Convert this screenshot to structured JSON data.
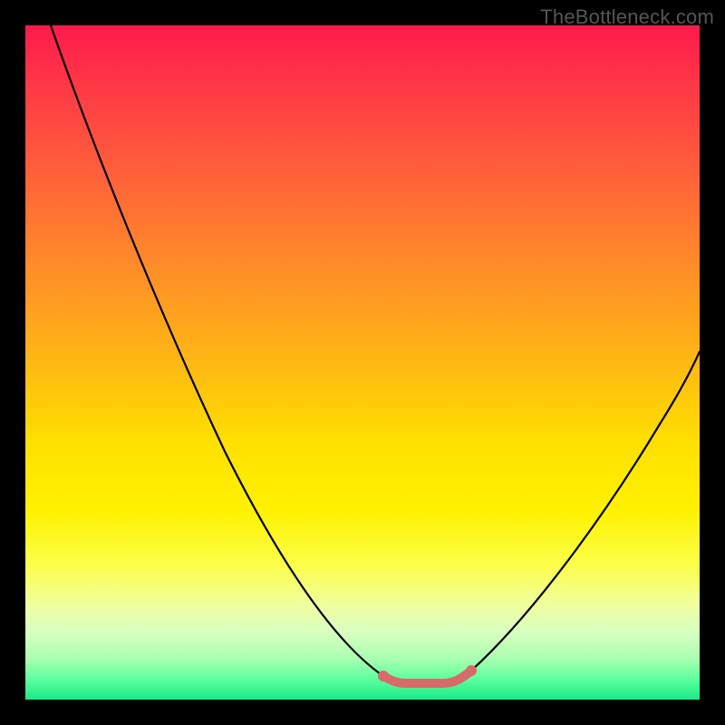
{
  "watermark": "TheBottleneck.com",
  "chart_data": {
    "type": "line",
    "title": "",
    "xlabel": "",
    "ylabel": "",
    "xlim": [
      0,
      100
    ],
    "ylim": [
      0,
      100
    ],
    "series": [
      {
        "name": "curve",
        "x": [
          0,
          5,
          10,
          15,
          20,
          25,
          30,
          35,
          40,
          45,
          50,
          52,
          55,
          58,
          60,
          62,
          65,
          70,
          75,
          80,
          85,
          90,
          95,
          100
        ],
        "y": [
          100,
          91,
          82,
          73,
          64,
          55,
          46,
          37,
          28,
          19,
          10,
          6,
          3,
          2,
          2,
          3,
          6,
          12,
          20,
          28,
          36,
          44,
          52,
          60
        ]
      },
      {
        "name": "flat-marker",
        "x": [
          52,
          54,
          56,
          58,
          60,
          62
        ],
        "y": [
          2,
          2,
          2,
          2,
          2,
          2
        ]
      }
    ],
    "background_gradient": {
      "direction": "vertical",
      "stops": [
        {
          "pos": 0.0,
          "color": "#ff1a4d"
        },
        {
          "pos": 0.5,
          "color": "#ffe000"
        },
        {
          "pos": 0.9,
          "color": "#d8ffc0"
        },
        {
          "pos": 1.0,
          "color": "#18e888"
        }
      ]
    },
    "curve_color": "#000000",
    "marker_color": "#d86a6a"
  }
}
